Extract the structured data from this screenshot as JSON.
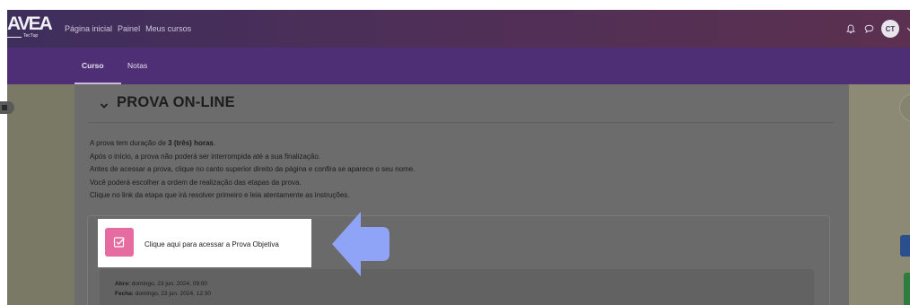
{
  "brand": {
    "logo_text": "AVEA",
    "logo_sub": "TecTup"
  },
  "topnav": [
    "Página inicial",
    "Painel",
    "Meus cursos"
  ],
  "user": {
    "initials": "CT"
  },
  "course_tabs": [
    {
      "label": "Curso",
      "active": true
    },
    {
      "label": "Notas",
      "active": false
    }
  ],
  "section": {
    "title": "PROVA ON-LINE",
    "intro_before": "A prova tem duração de ",
    "intro_bold": "3 (três) horas",
    "intro_after": ".",
    "lines": [
      "Após o início, a prova não poderá ser interrompida até a sua finalização.",
      "Antes de acessar a prova, clique no canto superior direito da página e confira se aparece o seu nome.",
      "Você poderá escolher a ordem de realização das etapas da prova.",
      "Clique no link da etapa que irá resolver primeiro e leia atentamente as instruções."
    ]
  },
  "activity": {
    "link_label": "Clique aqui para acessar a Prova Objetiva",
    "opens_label": "Abre:",
    "opens_value": " domingo, 23 jun. 2024, 09:00",
    "closes_label": "Fecha:",
    "closes_value": " domingo, 23 jun. 2024, 12:30"
  },
  "colors": {
    "topbar": "#4e2f58",
    "course_bar": "#4e2e74",
    "quiz_icon": "#e66ba0",
    "pointer_arrow": "#8fa4f6"
  },
  "icons": [
    "bell-icon",
    "chat-icon",
    "chevron-down-icon",
    "quiz-icon",
    "arrow-pointer-icon"
  ]
}
